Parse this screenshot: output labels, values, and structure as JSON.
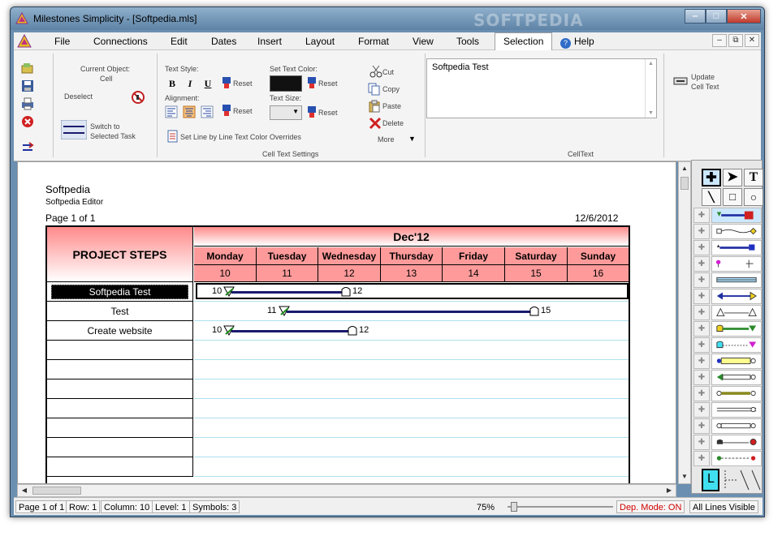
{
  "window": {
    "title": "Milestones Simplicity - [Softpedia.mls]",
    "watermark": "SOFTPEDIA"
  },
  "menu": {
    "items": [
      "File",
      "Connections",
      "Edit",
      "Dates",
      "Insert",
      "Layout",
      "Format",
      "View",
      "Tools",
      "Selection",
      "Help"
    ],
    "active": "Selection"
  },
  "ribbon": {
    "current_object_label": "Current Object:",
    "current_object_value": "Cell",
    "deselect": "Deselect",
    "switch_to": "Switch to",
    "selected_task": "Selected Task",
    "text_style_label": "Text Style:",
    "bold": "B",
    "italic": "I",
    "underline": "U",
    "reset": "Reset",
    "alignment_label": "Alignment:",
    "set_text_color_label": "Set Text Color:",
    "text_size_label": "Text Size:",
    "set_line_by_line": "Set Line by Line Text Color Overrides",
    "cell_text_settings": "Cell Text Settings",
    "cut": "Cut",
    "copy": "Copy",
    "paste": "Paste",
    "delete": "Delete",
    "more": "More",
    "celltext_value": "Softpedia Test",
    "celltext_group": "CellText",
    "update": "Update",
    "cell_text": "Cell Text"
  },
  "page": {
    "title": "Softpedia",
    "subtitle": "Softpedia Editor",
    "page_num": "Page 1 of 1",
    "date": "12/6/2012"
  },
  "chart": {
    "steps_header": "PROJECT STEPS",
    "month": "Dec'12",
    "days": [
      "Monday",
      "Tuesday",
      "Wednesday",
      "Thursday",
      "Friday",
      "Saturday",
      "Sunday"
    ],
    "dates": [
      "10",
      "11",
      "12",
      "13",
      "14",
      "15",
      "16"
    ],
    "rows": [
      {
        "label": "Softpedia Test",
        "start": "10",
        "end": "12",
        "selected": true
      },
      {
        "label": "Test",
        "start": "11",
        "end": "15",
        "selected": false
      },
      {
        "label": "Create website",
        "start": "10",
        "end": "12",
        "selected": false
      }
    ]
  },
  "status": {
    "page": "Page 1 of 1",
    "row": "Row: 1",
    "column": "Column: 10",
    "level": "Level: 1",
    "symbols": "Symbols: 3",
    "zoom": "75%",
    "dep_mode": "Dep. Mode: ON",
    "lines": "All Lines Visible"
  },
  "colors": {
    "header_red": "#ff9a9a",
    "bar_navy": "#1a1a6e",
    "dep_mode": "#d00000"
  }
}
